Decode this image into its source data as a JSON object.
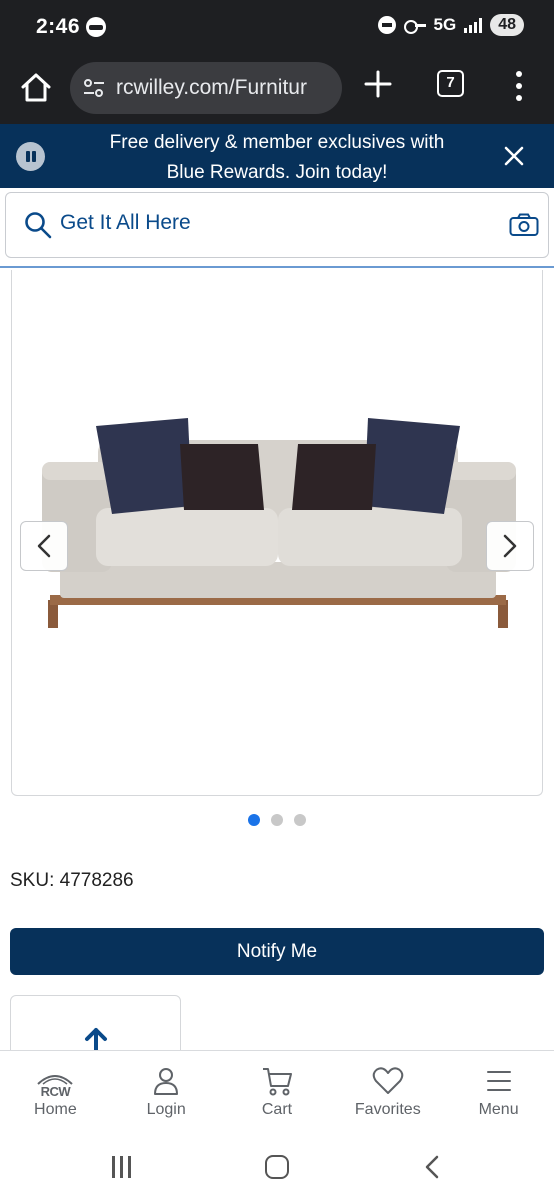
{
  "status_bar": {
    "time": "2:46",
    "network": "5G",
    "battery": "48"
  },
  "browser": {
    "url": "rcwilley.com/Furnitur",
    "tab_count": "7"
  },
  "promo": {
    "text_line1": "Free delivery & member exclusives with",
    "text_line2": "Blue Rewards. Join today!"
  },
  "search": {
    "placeholder": "Get It All Here"
  },
  "gallery": {
    "active_index": 0,
    "image_count": 3
  },
  "product": {
    "sku_label": "SKU:",
    "sku_value": "4778286",
    "notify_label": "Notify Me"
  },
  "bottom_nav": {
    "items": [
      {
        "label": "Home",
        "icon": "rcw-logo-icon",
        "logo_text": "RCW"
      },
      {
        "label": "Login",
        "icon": "person-icon"
      },
      {
        "label": "Cart",
        "icon": "cart-icon"
      },
      {
        "label": "Favorites",
        "icon": "heart-icon"
      },
      {
        "label": "Menu",
        "icon": "hamburger-icon"
      }
    ]
  },
  "colors": {
    "brand_navy": "#07315a",
    "link_blue": "#0a4a8a",
    "dot_active": "#1a73e8",
    "chrome_dark": "#1e1f22"
  }
}
